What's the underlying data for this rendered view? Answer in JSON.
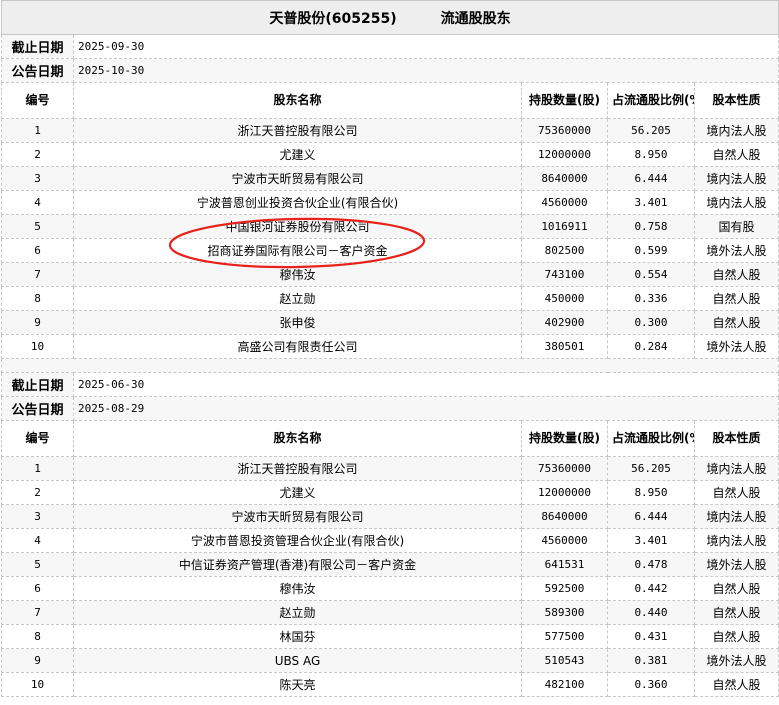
{
  "title": {
    "stock": "天普股份(605255)",
    "section": "流通股股东"
  },
  "labels": {
    "end_date": "截止日期",
    "announce_date": "公告日期"
  },
  "columns": [
    "编号",
    "股东名称",
    "持股数量(股)",
    "占流通股比例(%)",
    "股本性质"
  ],
  "annotation_color": "#e8221b",
  "periods": [
    {
      "end_date": "2025-09-30",
      "announce_date": "2025-10-30",
      "rows": [
        [
          "1",
          "浙江天普控股有限公司",
          "75360000",
          "56.205",
          "境内法人股"
        ],
        [
          "2",
          "尤建义",
          "12000000",
          "8.950",
          "自然人股"
        ],
        [
          "3",
          "宁波市天昕贸易有限公司",
          "8640000",
          "6.444",
          "境内法人股"
        ],
        [
          "4",
          "宁波普恩创业投资合伙企业(有限合伙)",
          "4560000",
          "3.401",
          "境内法人股"
        ],
        [
          "5",
          "中国银河证券股份有限公司",
          "1016911",
          "0.758",
          "国有股"
        ],
        [
          "6",
          "招商证券国际有限公司－客户资金",
          "802500",
          "0.599",
          "境外法人股"
        ],
        [
          "7",
          "穆伟汝",
          "743100",
          "0.554",
          "自然人股"
        ],
        [
          "8",
          "赵立勋",
          "450000",
          "0.336",
          "自然人股"
        ],
        [
          "9",
          "张申俊",
          "402900",
          "0.300",
          "自然人股"
        ],
        [
          "10",
          "高盛公司有限责任公司",
          "380501",
          "0.284",
          "境外法人股"
        ]
      ]
    },
    {
      "end_date": "2025-06-30",
      "announce_date": "2025-08-29",
      "rows": [
        [
          "1",
          "浙江天普控股有限公司",
          "75360000",
          "56.205",
          "境内法人股"
        ],
        [
          "2",
          "尤建义",
          "12000000",
          "8.950",
          "自然人股"
        ],
        [
          "3",
          "宁波市天昕贸易有限公司",
          "8640000",
          "6.444",
          "境内法人股"
        ],
        [
          "4",
          "宁波市普恩投资管理合伙企业(有限合伙)",
          "4560000",
          "3.401",
          "境内法人股"
        ],
        [
          "5",
          "中信证券资产管理(香港)有限公司－客户资金",
          "641531",
          "0.478",
          "境外法人股"
        ],
        [
          "6",
          "穆伟汝",
          "592500",
          "0.442",
          "自然人股"
        ],
        [
          "7",
          "赵立勋",
          "589300",
          "0.440",
          "自然人股"
        ],
        [
          "8",
          "林国芬",
          "577500",
          "0.431",
          "自然人股"
        ],
        [
          "9",
          "UBS AG",
          "510543",
          "0.381",
          "境外法人股"
        ],
        [
          "10",
          "陈天亮",
          "482100",
          "0.360",
          "自然人股"
        ]
      ]
    }
  ]
}
